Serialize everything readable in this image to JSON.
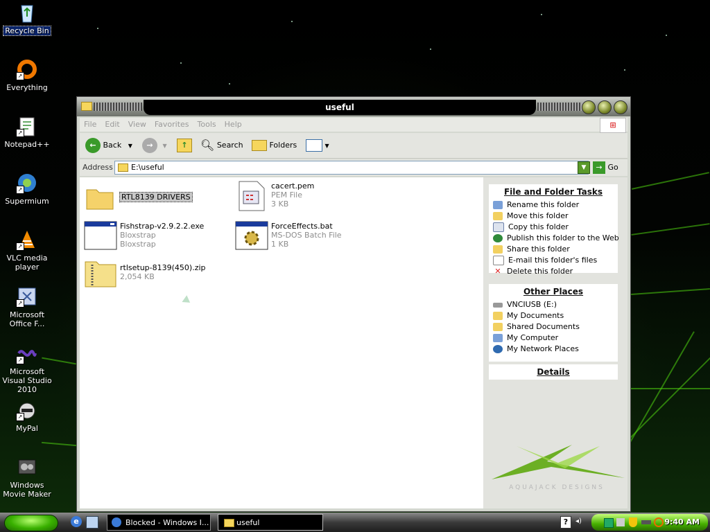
{
  "desktop": {
    "icons": [
      {
        "label": "Recycle Bin"
      },
      {
        "label": "Everything"
      },
      {
        "label": "Notepad++"
      },
      {
        "label": "Supermium"
      },
      {
        "label": "VLC media player"
      },
      {
        "label": "Microsoft Office F..."
      },
      {
        "label": "Microsoft Visual Studio 2010"
      },
      {
        "label": "MyPal"
      },
      {
        "label": "Windows Movie Maker"
      }
    ]
  },
  "window": {
    "title": "useful",
    "menu": [
      "File",
      "Edit",
      "View",
      "Favorites",
      "Tools",
      "Help"
    ],
    "toolbar": {
      "back": "Back",
      "search": "Search",
      "folders": "Folders"
    },
    "address": {
      "label": "Address",
      "value": "E:\\useful",
      "go": "Go"
    },
    "files": [
      {
        "name": "RTL8139 DRIVERS",
        "line2": "",
        "line3": ""
      },
      {
        "name": "cacert.pem",
        "line2": "PEM File",
        "line3": "3 KB"
      },
      {
        "name": "Fishstrap-v2.9.2.2.exe",
        "line2": "Bloxstrap",
        "line3": "Bloxstrap"
      },
      {
        "name": "ForceEffects.bat",
        "line2": "MS-DOS Batch File",
        "line3": "1 KB"
      },
      {
        "name": "rtlsetup-8139(450).zip",
        "line2": "2,054 KB",
        "line3": ""
      }
    ],
    "tasks": {
      "title": "File and Folder Tasks",
      "items": [
        "Rename this folder",
        "Move this folder",
        "Copy this folder",
        "Publish this folder to the Web",
        "Share this folder",
        "E-mail this folder's files",
        "Delete this folder"
      ]
    },
    "other_places": {
      "title": "Other Places",
      "items": [
        "VNCIUSB (E:)",
        "My Documents",
        "Shared Documents",
        "My Computer",
        "My Network Places"
      ]
    },
    "details": {
      "title": "Details"
    },
    "watermark": "AQUAJACK DESIGNS"
  },
  "taskbar": {
    "items": [
      "Blocked - Windows I...",
      "useful"
    ],
    "clock": "9:40 AM"
  },
  "colors": {
    "accent_green": "#46b000",
    "title_black": "#000000",
    "link_blue": "#0a246a"
  }
}
